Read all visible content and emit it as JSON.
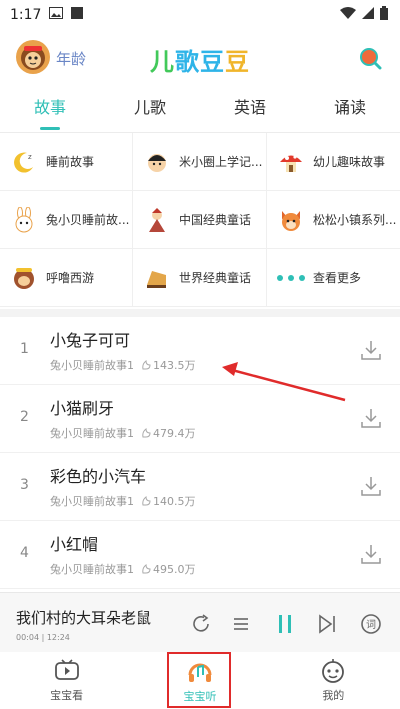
{
  "status": {
    "time": "1:17"
  },
  "header": {
    "age_label": "年龄",
    "logo": [
      "儿",
      "歌",
      "豆",
      "豆"
    ]
  },
  "tabs": [
    {
      "label": "故事",
      "active": true
    },
    {
      "label": "儿歌",
      "active": false
    },
    {
      "label": "英语",
      "active": false
    },
    {
      "label": "诵读",
      "active": false
    }
  ],
  "categories": [
    {
      "label": "睡前故事",
      "icon": "moon-sleep-icon"
    },
    {
      "label": "米小圈上学记...",
      "icon": "boy-character-icon"
    },
    {
      "label": "幼儿趣味故事",
      "icon": "mushroom-house-icon"
    },
    {
      "label": "兔小贝睡前故...",
      "icon": "rabbit-icon"
    },
    {
      "label": "中国经典童话",
      "icon": "chinese-opera-icon"
    },
    {
      "label": "松松小镇系列...",
      "icon": "squirrel-icon"
    },
    {
      "label": "呼噜西游",
      "icon": "monkey-icon"
    },
    {
      "label": "世界经典童话",
      "icon": "piano-icon"
    },
    {
      "label": "查看更多",
      "icon": "more-dots-icon"
    }
  ],
  "stories": [
    {
      "num": "1",
      "title": "小兔子可可",
      "album": "兔小贝睡前故事1",
      "plays": "143.5万"
    },
    {
      "num": "2",
      "title": "小猫刷牙",
      "album": "兔小贝睡前故事1",
      "plays": "479.4万"
    },
    {
      "num": "3",
      "title": "彩色的小汽车",
      "album": "兔小贝睡前故事1",
      "plays": "140.5万"
    },
    {
      "num": "4",
      "title": "小红帽",
      "album": "兔小贝睡前故事1",
      "plays": "495.0万"
    }
  ],
  "player": {
    "title": "我们村的大耳朵老鼠",
    "time": "00:04 | 12:24"
  },
  "nav": [
    {
      "label": "宝宝看",
      "active": false
    },
    {
      "label": "宝宝听",
      "active": true
    },
    {
      "label": "我的",
      "active": false
    }
  ],
  "colors": {
    "accent": "#2fbfb6",
    "annotation": "#e02b2b"
  }
}
